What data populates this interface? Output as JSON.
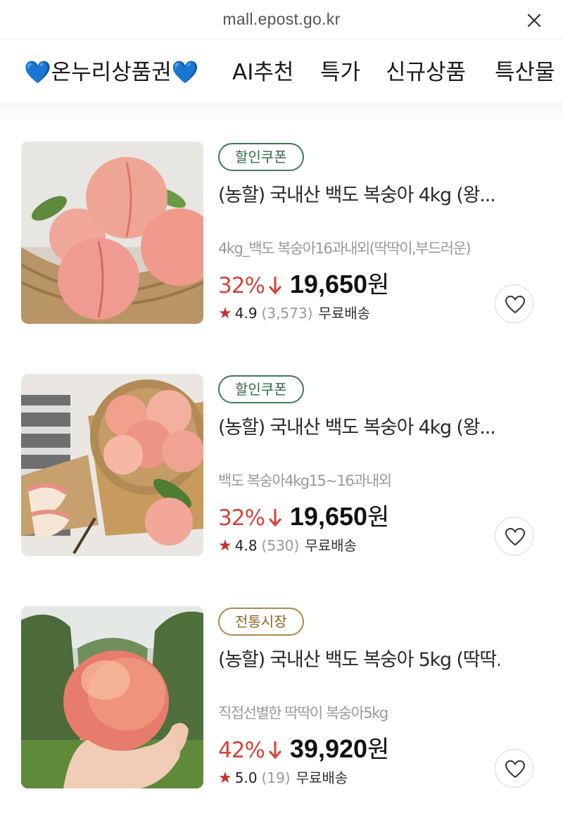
{
  "browser": {
    "url": "mall.epost.go.kr"
  },
  "nav": {
    "items": [
      "💙온누리상품권💙",
      "AI추천",
      "특가",
      "신규상품",
      "특산물"
    ]
  },
  "products": [
    {
      "badge": "할인쿠폰",
      "title": "(농할) 국내산 백도 복숭아 4kg (왕...",
      "subtitle": "4kg_백도 복숭아16과내외(딱딱이,부드러운)",
      "discount": "32%",
      "price": "19,650",
      "currency": "원",
      "rating": "4.9",
      "reviews": "(3,573)",
      "shipping": "무료배송"
    },
    {
      "badge": "할인쿠폰",
      "title": "(농할) 국내산 백도 복숭아 4kg (왕...",
      "subtitle": "백도 복숭아4kg15~16과내외",
      "discount": "32%",
      "price": "19,650",
      "currency": "원",
      "rating": "4.8",
      "reviews": "(530)",
      "shipping": "무료배송"
    },
    {
      "badge": "전통시장",
      "title": "(농할) 국내산 백도 복숭아 5kg (딱딱...",
      "subtitle": "직접선별한 딱딱이 복숭아5kg",
      "discount": "42%",
      "price": "39,920",
      "currency": "원",
      "rating": "5.0",
      "reviews": "(19)",
      "shipping": "무료배송"
    }
  ],
  "colors": {
    "discount": "#d8433a",
    "star": "#c8302c",
    "coupon_badge": "#3f7a58",
    "market_badge": "#b08a4a"
  },
  "icons": {
    "close": "close-icon",
    "like": "heart-icon",
    "rating": "star-icon",
    "discount": "down-arrow-icon"
  }
}
